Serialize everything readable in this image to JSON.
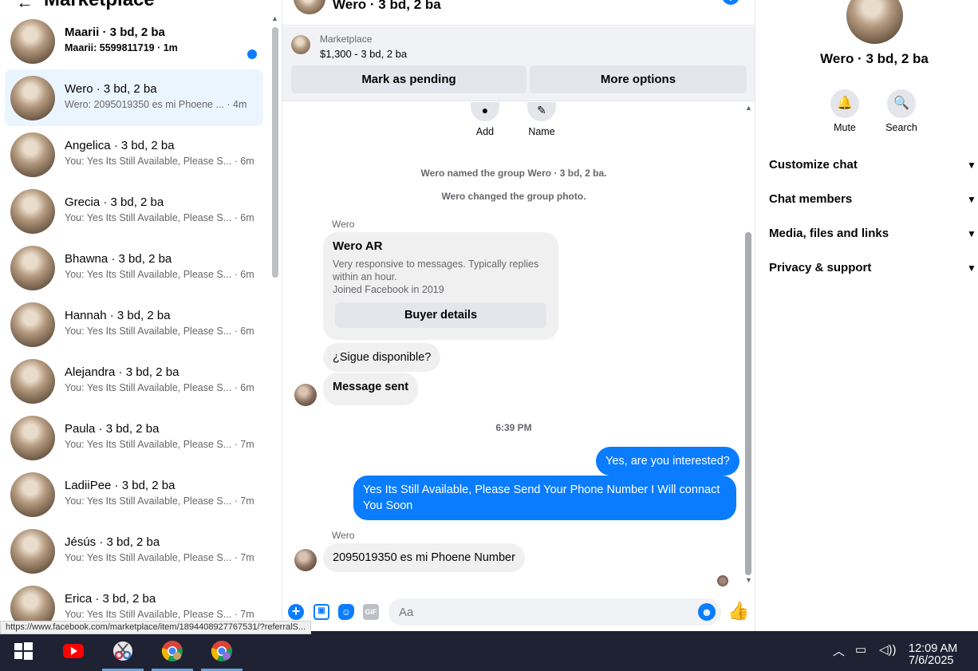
{
  "left": {
    "back_glyph": "←",
    "title": "Marketplace",
    "conversations": [
      {
        "name": "Maarii · 3 bd, 2 ba",
        "preview": "Maarii: 5599811719",
        "time": "· 1m",
        "unread": true
      },
      {
        "name": "Wero · 3 bd, 2 ba",
        "preview": "Wero: 2095019350 es mi Phoene ...",
        "time": "· 4m",
        "active": true
      },
      {
        "name": "Angelica · 3 bd, 2 ba",
        "preview": "You: Yes Its Still Available, Please S...",
        "time": "· 6m"
      },
      {
        "name": "Grecia · 3 bd, 2 ba",
        "preview": "You: Yes Its Still Available, Please S...",
        "time": "· 6m"
      },
      {
        "name": "Bhawna · 3 bd, 2 ba",
        "preview": "You: Yes Its Still Available, Please S...",
        "time": "· 6m"
      },
      {
        "name": "Hannah · 3 bd, 2 ba",
        "preview": "You: Yes Its Still Available, Please S...",
        "time": "· 6m"
      },
      {
        "name": "Alejandra · 3 bd, 2 ba",
        "preview": "You: Yes Its Still Available, Please S...",
        "time": "· 6m"
      },
      {
        "name": "Paula · 3 bd, 2 ba",
        "preview": "You: Yes Its Still Available, Please S...",
        "time": "· 7m"
      },
      {
        "name": "LadiiPee · 3 bd, 2 ba",
        "preview": "You: Yes Its Still Available, Please S...",
        "time": "· 7m"
      },
      {
        "name": "Jésús · 3 bd, 2 ba",
        "preview": "You: Yes Its Still Available, Please S...",
        "time": "· 7m"
      },
      {
        "name": "Erica · 3 bd, 2 ba",
        "preview": "You: Yes Its Still Available, Please S...",
        "time": "· 7m"
      }
    ]
  },
  "chat": {
    "title": "Wero · 3 bd, 2 ba",
    "info_glyph": "i",
    "marketplace_label": "Marketplace",
    "listing": "$1,300 - 3 bd, 2 ba",
    "mark_pending": "Mark as pending",
    "more_options": "More options",
    "actions": {
      "add": "Add",
      "name": "Name"
    },
    "system_messages": [
      "Wero named the group Wero · 3 bd, 2 ba.",
      "Wero changed the group photo."
    ],
    "sender": "Wero",
    "card": {
      "title": "Wero AR",
      "line1": "Very responsive to messages. Typically replies within an hour.",
      "line2": "Joined Facebook in 2019",
      "button": "Buyer details"
    },
    "msg_sigue": "¿Sigue disponible?",
    "msg_sent": "Message sent",
    "time_sep": "6:39 PM",
    "out_1": "Yes, are you interested?",
    "out_2_line1": "Yes Its Still Available, Please Send Your Phone Number I Will connact",
    "out_2_line2": "You Soon",
    "sender_2": "Wero",
    "msg_phone": "2095019350 es mi Phoene Number",
    "input_placeholder": "Aa",
    "gif_label": "GIF"
  },
  "right": {
    "name": "Wero · 3 bd, 2 ba",
    "mute": "Mute",
    "search": "Search",
    "sections": [
      "Customize chat",
      "Chat members",
      "Media, files and links",
      "Privacy & support"
    ]
  },
  "status_url": "https://www.facebook.com/marketplace/item/1894408927767531/?referralS...",
  "taskbar": {
    "time": "12:09 AM",
    "date": "7/6/2025"
  },
  "colors": {
    "accent": "#0a7cff",
    "active_row": "#ebf5ff",
    "taskbar": "#1e2232"
  }
}
